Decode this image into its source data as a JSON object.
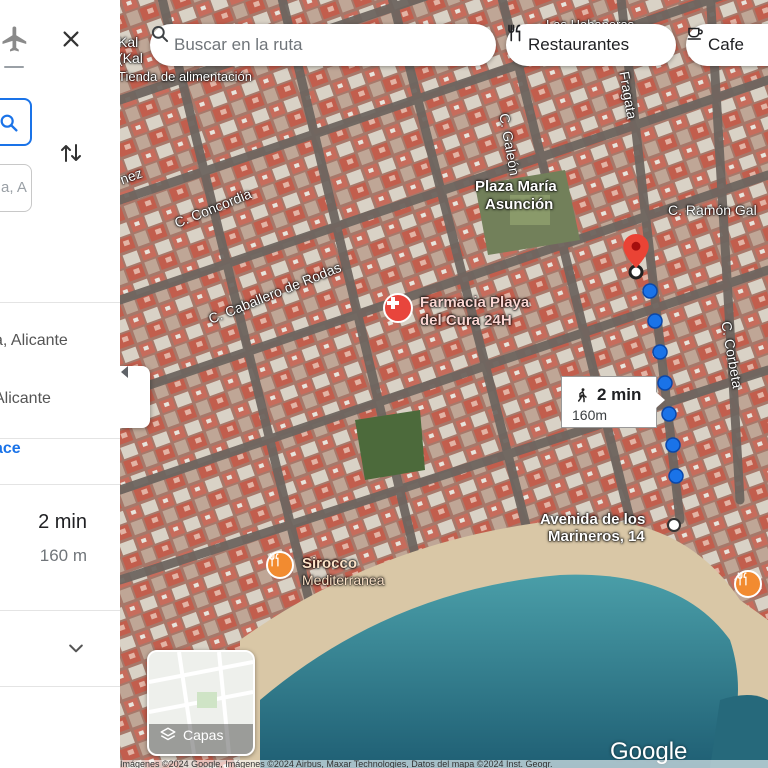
{
  "panel": {
    "origin_placeholder": "",
    "destination_placeholder": "a, A",
    "suggestion_1": "a, Alicante",
    "suggestion_2": "Alicante",
    "link_text": "ace",
    "route_duration": "2 min",
    "route_distance": "160 m"
  },
  "map": {
    "search_placeholder": "Buscar en la ruta",
    "chips": [
      "Restaurantes",
      "Cafe"
    ],
    "route_badge": {
      "duration": "2 min",
      "distance": "160m"
    },
    "labels": {
      "top_left_1": "Kal",
      "top_left_2": "(Kal",
      "grocery": "Tienda de alimentación",
      "street_galeon": "C. Galeón",
      "street_fragata": "Fragata",
      "street_nez": "nez",
      "street_concordia": "C. Concordia",
      "street_caballero": "C. Caballero de Rodas",
      "street_corbeta": "C. Corbeta",
      "street_ramon": "C. Ramón Gal",
      "street_habaneras": "Las Habaneras",
      "plaza_line1": "Plaza María",
      "plaza_line2": "Asunción",
      "pharmacy_line1": "Farmacia Playa",
      "pharmacy_line2": "del Cura 24H",
      "destination_line1": "Avenida de los",
      "destination_line2": "Marineros, 14",
      "restaurant_line1": "Sirocco",
      "restaurant_line2": "Mediterranea",
      "layers": "Capas",
      "google": "Google",
      "attribution": "Imágenes ©2024 Google, Imágenes ©2024 Airbus, Maxar Technologies, Datos del mapa ©2024 Inst. Geogr."
    },
    "colors": {
      "route": "#1a73e8",
      "pin": "#ea4335",
      "poi_orange": "#f28b30",
      "pharmacy": "#e8453c"
    }
  }
}
